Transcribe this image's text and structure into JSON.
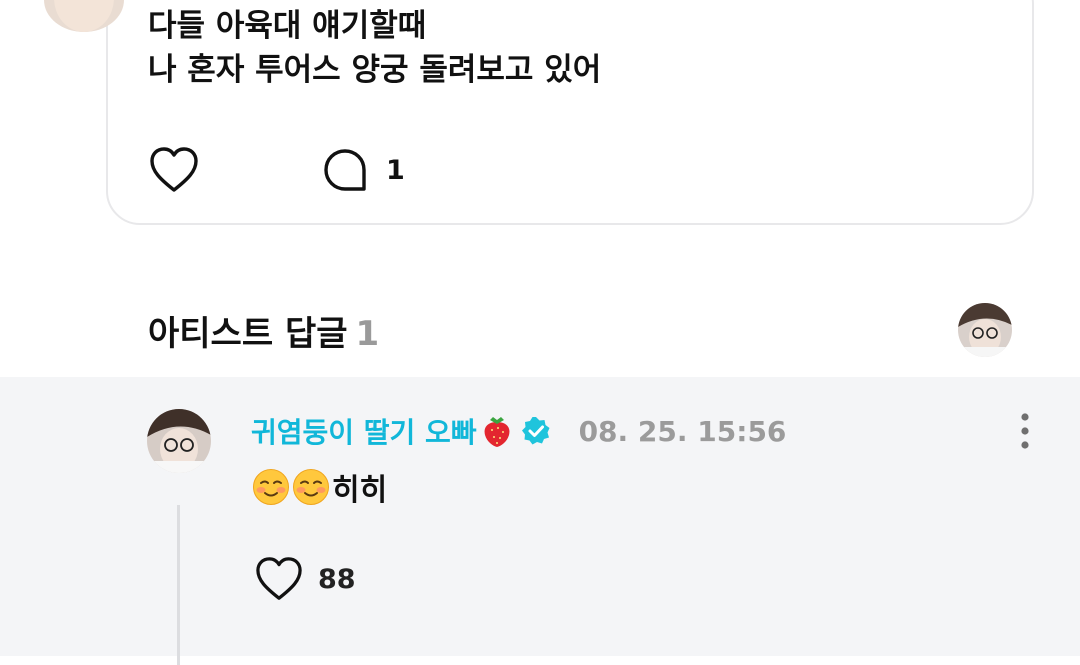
{
  "post": {
    "lines": [
      "다들 아육대 얘기할때",
      "나 혼자 투어스 양궁 돌려보고 있어"
    ],
    "like_icon": "heart-outline-icon",
    "comment_icon": "speech-bubble-icon",
    "comment_count": "1"
  },
  "artist_replies": {
    "title": "아티스트 답글",
    "count": "1"
  },
  "reply": {
    "author": "귀염둥이 딸기 오빠",
    "author_emoji": "strawberry-icon",
    "verified_icon": "verified-badge-icon",
    "time": "08. 25. 15:56",
    "text_suffix": "히히",
    "text_emoji": "smiling-face-icon",
    "like_count": "88",
    "more_icon": "vertical-dots-icon"
  },
  "colors": {
    "author": "#11b7d9",
    "verified": "#1fc4dc",
    "muted": "#9b9b9b",
    "reply_bg": "#f4f5f7",
    "card_border": "#e8e8ea"
  }
}
